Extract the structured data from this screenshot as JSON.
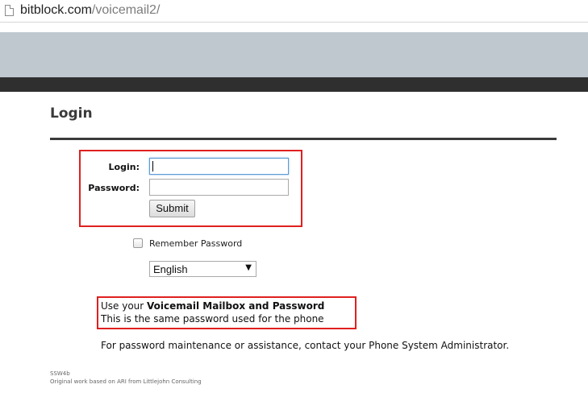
{
  "browser": {
    "url_domain": "bitblock.com",
    "url_path": "/voicemail2/"
  },
  "page": {
    "title": "Login"
  },
  "form": {
    "login_label": "Login:",
    "login_value": "",
    "password_label": "Password:",
    "password_value": "",
    "submit_label": "Submit",
    "remember_label": "Remember Password",
    "remember_checked": false,
    "language_selected": "English"
  },
  "notes": {
    "line1_prefix": "Use your ",
    "line1_bold": "Voicemail Mailbox and Password",
    "line2": "This is the same password used for the phone",
    "line3": "For password maintenance or assistance, contact your Phone System Administrator."
  },
  "footer": {
    "version": "SSW4b",
    "credit": "Original work based on ARI from Littlejohn Consulting"
  },
  "colors": {
    "banner": "#bfc7cf",
    "dark_bar": "#2f2f2f",
    "highlight_box": "#e02020",
    "title": "#3a3a3a"
  },
  "icons": {
    "page": "page-icon",
    "select_arrow": "chevron-down-icon"
  }
}
